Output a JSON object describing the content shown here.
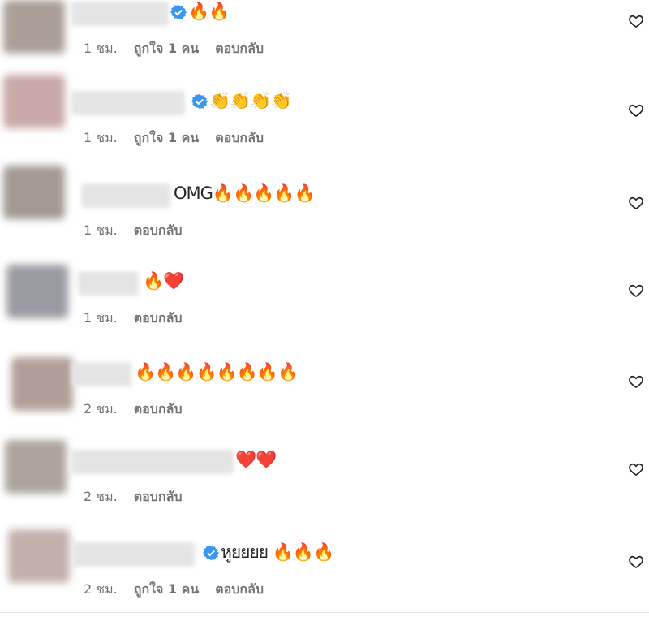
{
  "comments": [
    {
      "text": "🔥🔥",
      "verified": true,
      "time": "1 ชม.",
      "likes": "ถูกใจ 1 คน",
      "reply": "ตอบกลับ",
      "avatar_color": "#a99f97"
    },
    {
      "text": "👏👏👏👏",
      "verified": true,
      "time": "1 ชม.",
      "likes": "ถูกใจ 1 คน",
      "reply": "ตอบกลับ",
      "avatar_color": "#c9a9a6"
    },
    {
      "text": "OMG🔥🔥🔥🔥🔥",
      "verified": false,
      "time": "1 ชม.",
      "likes": "",
      "reply": "ตอบกลับ",
      "avatar_color": "#a39b93"
    },
    {
      "text": "🔥❤️",
      "verified": false,
      "time": "1 ชม.",
      "likes": "",
      "reply": "ตอบกลับ",
      "avatar_color": "#9a9aa2"
    },
    {
      "text": "🔥🔥🔥🔥🔥🔥🔥🔥",
      "verified": false,
      "time": "2 ชม.",
      "likes": "",
      "reply": "ตอบกลับ",
      "avatar_color": "#b19f97"
    },
    {
      "text": "❤️❤️",
      "verified": false,
      "time": "2 ชม.",
      "likes": "",
      "reply": "ตอบกลับ",
      "avatar_color": "#aca49c"
    },
    {
      "text": "หูยยยย 🔥🔥🔥",
      "verified": true,
      "time": "2 ชม.",
      "likes": "ถูกใจ 1 คน",
      "reply": "ตอบกลับ",
      "avatar_color": "#c2b0ab"
    }
  ]
}
